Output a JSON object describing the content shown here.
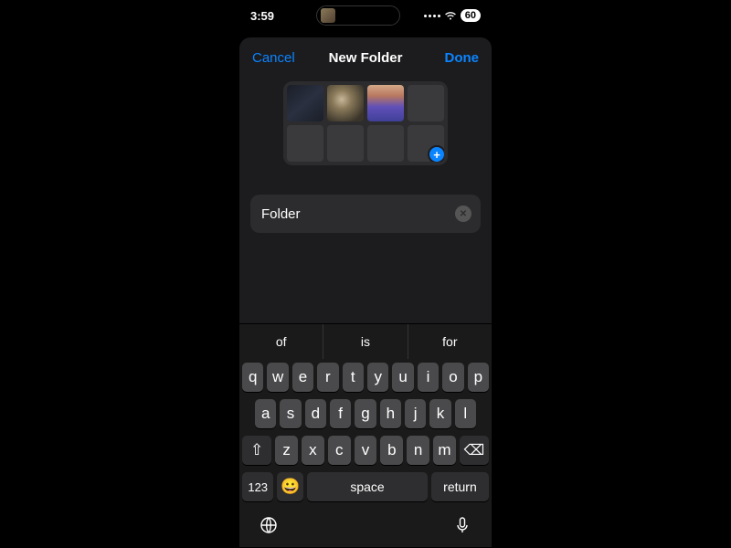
{
  "status": {
    "time": "3:59",
    "battery": "60"
  },
  "nav": {
    "cancel": "Cancel",
    "title": "New Folder",
    "done": "Done"
  },
  "folder_name_input": {
    "value": "Folder"
  },
  "keyboard": {
    "suggestions": [
      "of",
      "is",
      "for"
    ],
    "row1": [
      "q",
      "w",
      "e",
      "r",
      "t",
      "y",
      "u",
      "i",
      "o",
      "p"
    ],
    "row2": [
      "a",
      "s",
      "d",
      "f",
      "g",
      "h",
      "j",
      "k",
      "l"
    ],
    "row3": [
      "z",
      "x",
      "c",
      "v",
      "b",
      "n",
      "m"
    ],
    "numbers_key": "123",
    "emoji_key": "😀",
    "space_key": "space",
    "return_key": "return"
  }
}
